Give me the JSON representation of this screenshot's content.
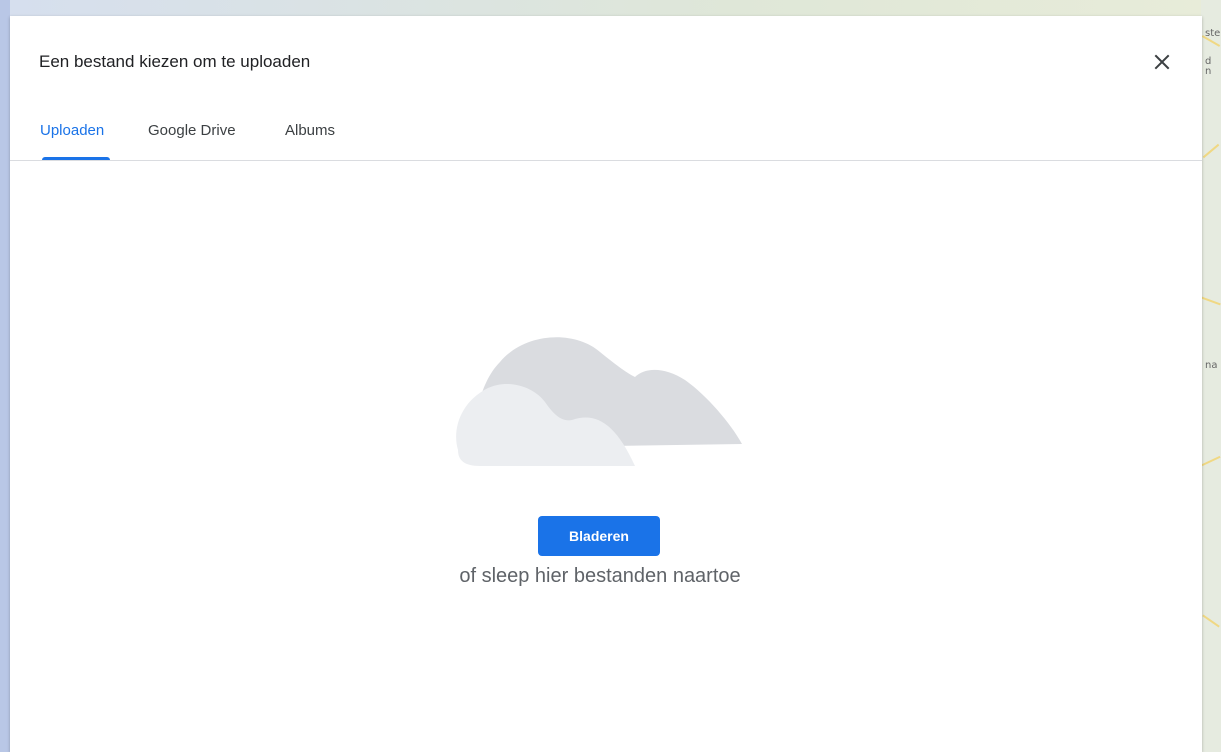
{
  "dialog": {
    "title": "Een bestand kiezen om te uploaden",
    "close_icon": "close-icon"
  },
  "tabs": [
    {
      "label": "Uploaden",
      "active": true
    },
    {
      "label": "Google Drive",
      "active": false
    },
    {
      "label": "Albums",
      "active": false
    }
  ],
  "upload": {
    "illustration": "cloud-icon",
    "browse_label": "Bladeren",
    "drop_hint": "of sleep hier bestanden naartoe"
  },
  "map_labels": [
    "ste",
    "d",
    "n",
    "na"
  ],
  "colors": {
    "accent": "#1a73e8",
    "cloud_dark": "#dadce0",
    "cloud_light": "#e8eaed"
  }
}
